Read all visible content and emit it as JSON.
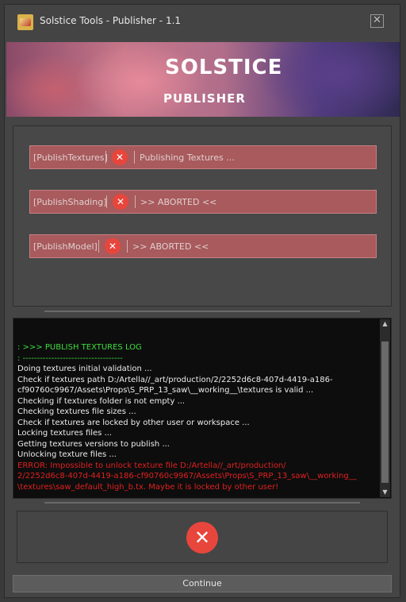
{
  "window": {
    "title": "Solstice Tools - Publisher - 1.1",
    "close_icon": "close-icon"
  },
  "banner": {
    "logo": "SOLSTICE",
    "subtitle": "PUBLISHER"
  },
  "steps": [
    {
      "name": "[PublishTextures]",
      "state": "error",
      "status": "Publishing Textures ..."
    },
    {
      "name": "[PublishShading]",
      "state": "error",
      "status": ">> ABORTED <<"
    },
    {
      "name": "[PublishModel]",
      "state": "error",
      "status": ">> ABORTED <<"
    }
  ],
  "log": {
    "lines": [
      {
        "text": ": >>> PUBLISH TEXTURES LOG",
        "color": "green"
      },
      {
        "text": ": -----------------------------------",
        "color": "green"
      },
      {
        "text": "Doing textures initial validation ...",
        "color": "white"
      },
      {
        "text": "Check if textures path D:/Artella//_art/production/2/2252d6c8-407d-4419-a186-",
        "color": "white"
      },
      {
        "text": "cf90760c9967/Assets\\Props\\S_PRP_13_saw\\__working__\\textures is valid ...",
        "color": "white"
      },
      {
        "text": "Checking if textures folder is not empty ...",
        "color": "white"
      },
      {
        "text": "Checking textures file sizes ...",
        "color": "white"
      },
      {
        "text": "Check if textures are locked by other user or workspace ...",
        "color": "white"
      },
      {
        "text": "Locking textures files ...",
        "color": "white"
      },
      {
        "text": "Getting textures versions to publish ...",
        "color": "white"
      },
      {
        "text": "Unlocking texture files ...",
        "color": "white"
      },
      {
        "text": "ERROR: Impossible to unlock texture file D:/Artella//_art/production/",
        "color": "red"
      },
      {
        "text": "2/2252d6c8-407d-4419-a186-cf90760c9967/Assets\\Props\\S_PRP_13_saw\\__working__",
        "color": "red"
      },
      {
        "text": "\\textures\\saw_default_high_b.tx. Maybe it is locked by other user!",
        "color": "red"
      }
    ]
  },
  "result": {
    "state": "error",
    "icon": "error-x-icon"
  },
  "continue_label": "Continue",
  "colors": {
    "error": "#e8463c",
    "step_bg": "#a85a5c",
    "log_green": "#3ede3e",
    "log_red": "#e02020"
  }
}
